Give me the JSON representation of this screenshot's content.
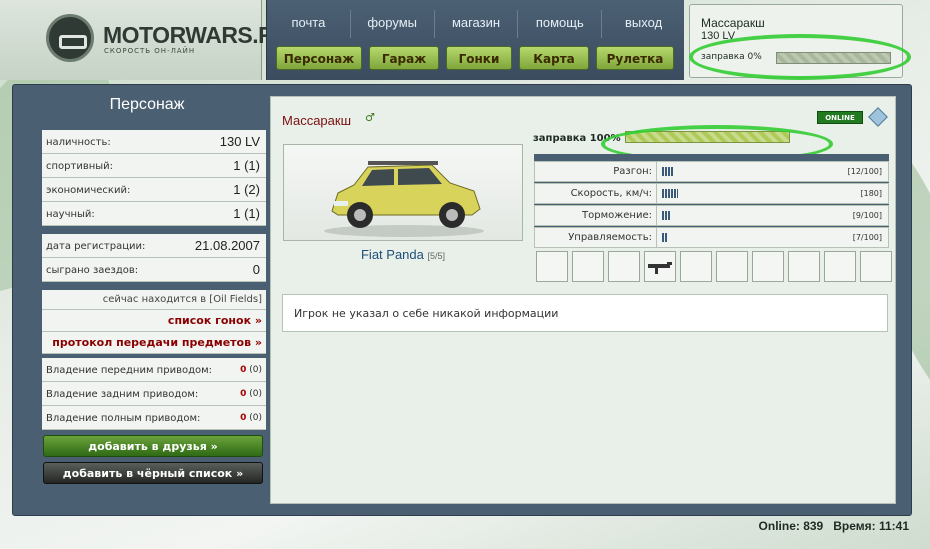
{
  "header": {
    "logo_text": "MOTORWARS.RU",
    "logo_sub": "СКОРОСТЬ ОН-ЛАЙН",
    "topnav": [
      "почта",
      "форумы",
      "магазин",
      "помощь",
      "выход"
    ],
    "mainnav": [
      "Персонаж",
      "Гараж",
      "Гонки",
      "Карта",
      "Рулетка"
    ]
  },
  "userbox": {
    "name": "Массаракш",
    "money": "130 LV",
    "fuel_label": "заправка 0%",
    "fuel_percent": 0
  },
  "left": {
    "title": "Персонаж",
    "rows1": [
      {
        "k": "наличность:",
        "v": "130 LV"
      },
      {
        "k": "спортивный:",
        "v": "1 (1)"
      },
      {
        "k": "экономический:",
        "v": "1 (2)"
      },
      {
        "k": "научный:",
        "v": "1 (1)"
      }
    ],
    "rows2": [
      {
        "k": "дата регистрации:",
        "v": "21.08.2007"
      },
      {
        "k": "сыграно заездов:",
        "v": "0"
      }
    ],
    "location": "сейчас находится в [Oil Fields]",
    "race_list": "список гонок »",
    "transfer_log": "протокол передачи предметов »",
    "drive_rows": [
      {
        "k": "Владение передним приводом:",
        "v": "0",
        "v2": "(0)"
      },
      {
        "k": "Владение задним приводом:",
        "v": "0",
        "v2": "(0)"
      },
      {
        "k": "Владение полным приводом:",
        "v": "0",
        "v2": "(0)"
      }
    ],
    "btn_friends": "добавить в друзья »",
    "btn_black": "добавить в чёрный список »"
  },
  "content": {
    "player": "Массаракш",
    "male_symbol": "♂",
    "online": "ONLINE",
    "car_name": "Fiat Panda",
    "car_grade": "[5/5]",
    "fuel_label": "заправка 100%",
    "fuel_percent": 100,
    "stats": [
      {
        "label": "Разгон:",
        "value": "[12/100]",
        "level": 12
      },
      {
        "label": "Скорость, км/ч:",
        "value": "[180]",
        "level": 18
      },
      {
        "label": "Торможение:",
        "value": "[9/100]",
        "level": 9
      },
      {
        "label": "Управляемость:",
        "value": "[7/100]",
        "level": 7
      }
    ],
    "about": "Игрок не указал о себе никакой информации"
  },
  "footer": {
    "online": "Online: 839",
    "time": "Время: 11:41"
  },
  "colors": {
    "frame": "#4b5f72",
    "nav_green": "#9bc652",
    "halo": "#33cc33",
    "red_link": "#8a0000"
  }
}
